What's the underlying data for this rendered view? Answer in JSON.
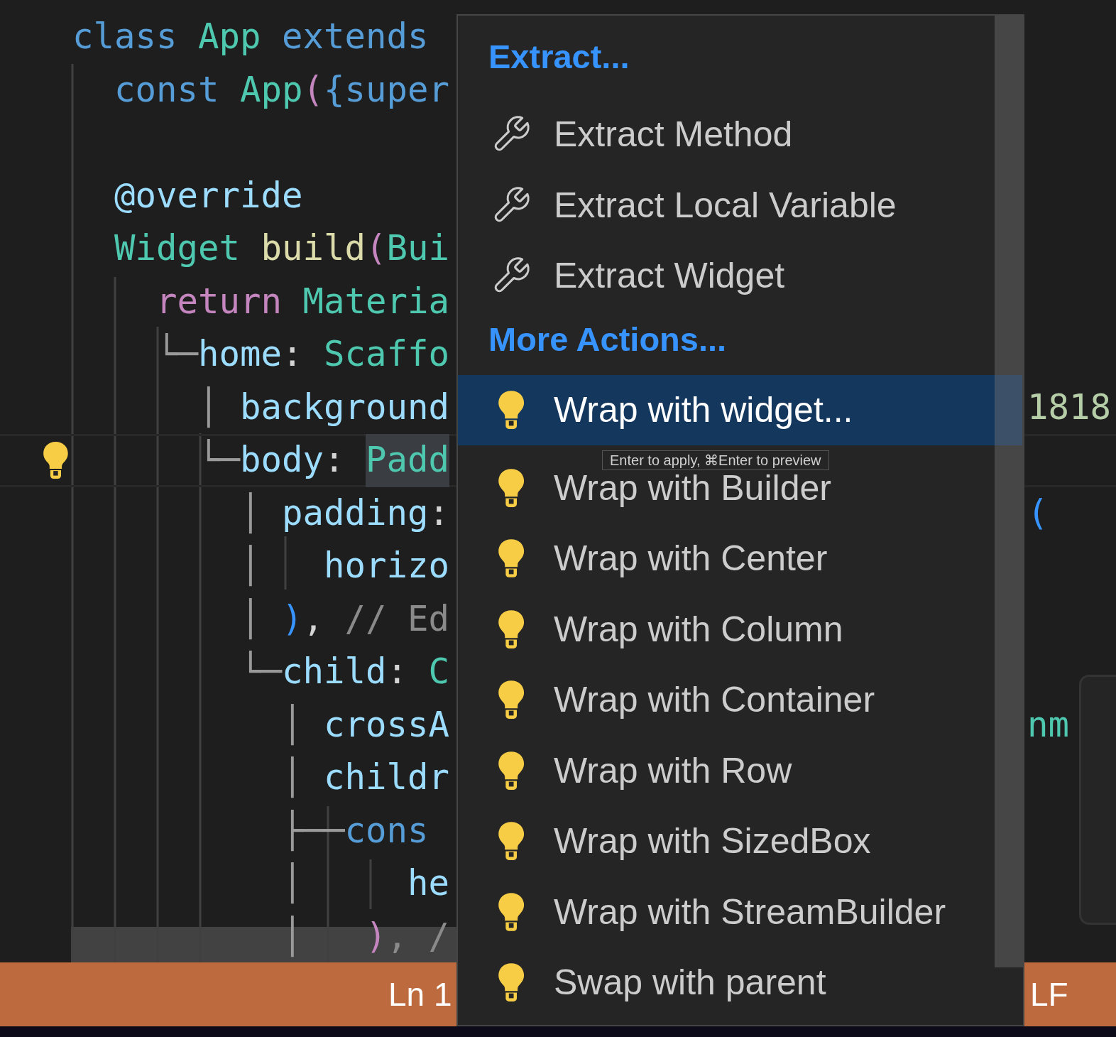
{
  "editor": {
    "blocks": [
      [
        {
          "tokens": [
            {
              "text": "class ",
              "kind": "keyword"
            },
            {
              "text": "App ",
              "kind": "type"
            },
            {
              "text": "extends",
              "kind": "keyword"
            }
          ]
        },
        {
          "tokens": [
            {
              "text": "  const ",
              "kind": "keyword"
            },
            {
              "text": "App",
              "kind": "type"
            },
            {
              "text": "(",
              "kind": "paren"
            },
            {
              "text": "{super",
              "kind": "keyword"
            }
          ]
        }
      ],
      [
        {
          "tokens": [
            {
              "text": "  @override",
              "kind": "property"
            }
          ]
        },
        {
          "tokens": [
            {
              "text": "  Widget ",
              "kind": "type"
            },
            {
              "text": "build",
              "kind": "function"
            },
            {
              "text": "(",
              "kind": "paren"
            },
            {
              "text": "Bui",
              "kind": "type"
            }
          ]
        },
        {
          "tokens": [
            {
              "text": "    return ",
              "kind": "control"
            },
            {
              "text": "Materia",
              "kind": "type"
            }
          ]
        },
        {
          "tokens": [
            {
              "text": "    └─",
              "kind": "guide"
            },
            {
              "text": "home",
              "kind": "property"
            },
            {
              "text": ": ",
              "kind": "punct"
            },
            {
              "text": "Scaffo",
              "kind": "type"
            }
          ]
        },
        {
          "tokens": [
            {
              "text": "      │ ",
              "kind": "guide"
            },
            {
              "text": "background",
              "kind": "property"
            }
          ],
          "right": {
            "text": "1818",
            "kind": "number"
          }
        },
        {
          "current": true,
          "lightbulb": true,
          "tokens": [
            {
              "text": "      └─",
              "kind": "guide"
            },
            {
              "text": "body",
              "kind": "property"
            },
            {
              "text": ": ",
              "kind": "punct"
            },
            {
              "text": "Padd",
              "kind": "type",
              "highlight": true
            }
          ]
        },
        {
          "tokens": [
            {
              "text": "        │ ",
              "kind": "guide"
            },
            {
              "text": "padding",
              "kind": "property"
            },
            {
              "text": ":",
              "kind": "punct"
            }
          ],
          "right": {
            "text": "(",
            "kind": "bracket"
          }
        },
        {
          "tokens": [
            {
              "text": "        │   ",
              "kind": "guide"
            },
            {
              "text": "horizo",
              "kind": "property"
            }
          ]
        },
        {
          "tokens": [
            {
              "text": "        │ ",
              "kind": "guide"
            },
            {
              "text": ")",
              "kind": "bracket"
            },
            {
              "text": ", ",
              "kind": "punct"
            },
            {
              "text": "// Ed",
              "kind": "comment"
            }
          ]
        },
        {
          "tokens": [
            {
              "text": "        └─",
              "kind": "guide"
            },
            {
              "text": "child",
              "kind": "property"
            },
            {
              "text": ": ",
              "kind": "punct"
            },
            {
              "text": "C",
              "kind": "type"
            }
          ]
        },
        {
          "tokens": [
            {
              "text": "          │ ",
              "kind": "guide"
            },
            {
              "text": "crossA",
              "kind": "property"
            }
          ],
          "right": {
            "text": "nm",
            "kind": "type"
          }
        },
        {
          "tokens": [
            {
              "text": "          │ ",
              "kind": "guide"
            },
            {
              "text": "childr",
              "kind": "property"
            }
          ]
        },
        {
          "tokens": [
            {
              "text": "          ├──",
              "kind": "guide"
            },
            {
              "text": "cons",
              "kind": "keyword"
            }
          ]
        },
        {
          "tokens": [
            {
              "text": "          │     ",
              "kind": "guide"
            },
            {
              "text": "he",
              "kind": "property"
            }
          ]
        },
        {
          "tokens": [
            {
              "text": "          │   ",
              "kind": "guide"
            },
            {
              "text": ")",
              "kind": "paren"
            },
            {
              "text": ", /",
              "kind": "comment"
            }
          ]
        }
      ]
    ]
  },
  "status_bar": {
    "position": "Ln 1",
    "line_ending": "LF"
  },
  "menu": {
    "groups": [
      {
        "title": "Extract...",
        "items": [
          {
            "label": "Extract Method",
            "kind": "extract",
            "selected": false
          },
          {
            "label": "Extract Local Variable",
            "kind": "extract",
            "selected": false
          },
          {
            "label": "Extract Widget",
            "kind": "extract",
            "selected": false
          }
        ]
      },
      {
        "title": "More Actions...",
        "items": [
          {
            "label": "Wrap with widget...",
            "kind": "wrap",
            "selected": true
          },
          {
            "label": "Wrap with Builder",
            "kind": "wrap",
            "selected": false
          },
          {
            "label": "Wrap with Center",
            "kind": "wrap",
            "selected": false
          },
          {
            "label": "Wrap with Column",
            "kind": "wrap",
            "selected": false
          },
          {
            "label": "Wrap with Container",
            "kind": "wrap",
            "selected": false
          },
          {
            "label": "Wrap with Row",
            "kind": "wrap",
            "selected": false
          },
          {
            "label": "Wrap with SizedBox",
            "kind": "wrap",
            "selected": false
          },
          {
            "label": "Wrap with StreamBuilder",
            "kind": "wrap",
            "selected": false
          },
          {
            "label": "Swap with parent",
            "kind": "wrap",
            "selected": false
          }
        ]
      }
    ],
    "tooltip": "Enter to apply, ⌘Enter to preview"
  }
}
